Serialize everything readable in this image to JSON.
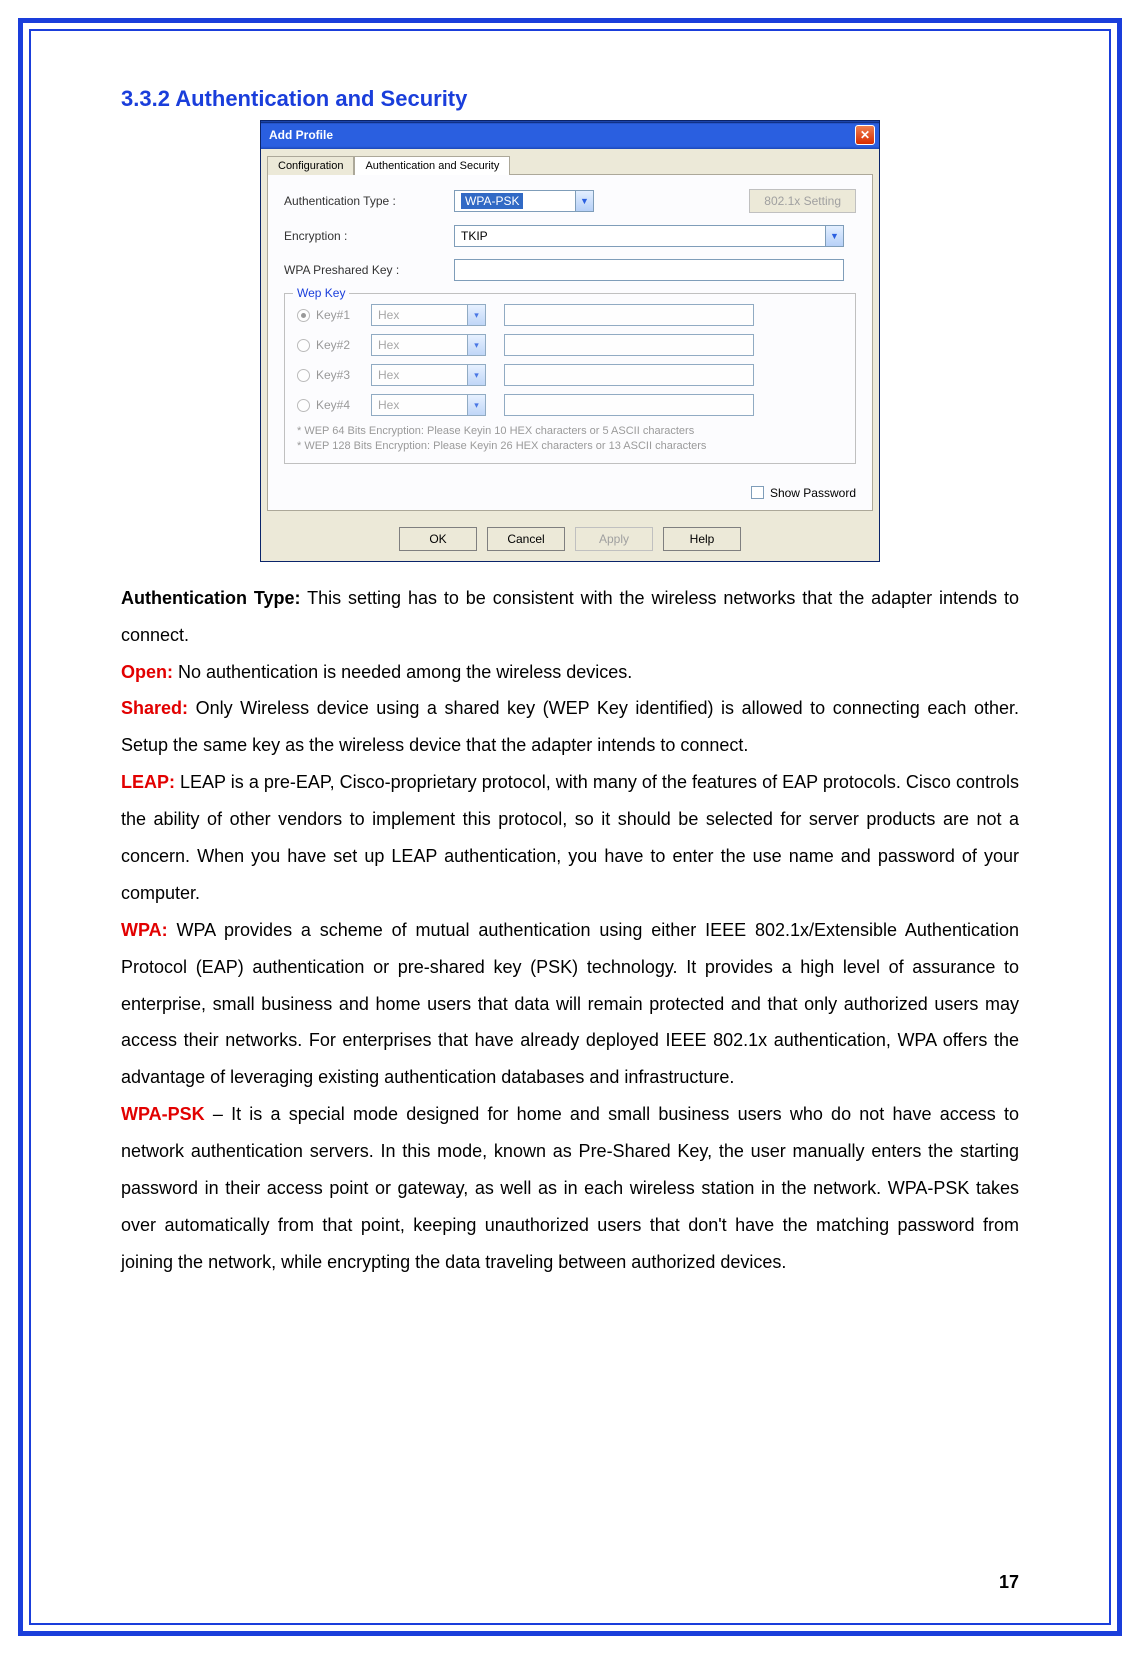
{
  "section_title": "3.3.2 Authentication and Security",
  "dialog": {
    "title": "Add Profile",
    "close_glyph": "✕",
    "tabs": {
      "config": "Configuration",
      "auth": "Authentication and Security"
    },
    "labels": {
      "auth_type": "Authentication Type :",
      "encryption": "Encryption :",
      "psk": "WPA Preshared Key :",
      "dot1x": "802.1x Setting",
      "wep_legend": "Wep Key",
      "show_pw": "Show Password"
    },
    "auth_type_value": "WPA-PSK",
    "encryption_value": "TKIP",
    "wep": {
      "key1": "Key#1",
      "key2": "Key#2",
      "key3": "Key#3",
      "key4": "Key#4",
      "hex": "Hex"
    },
    "hints": {
      "line1": "* WEP 64 Bits Encryption:  Please Keyin 10 HEX characters or 5 ASCII characters",
      "line2": "* WEP 128 Bits Encryption:  Please Keyin 26 HEX characters or 13 ASCII characters"
    },
    "buttons": {
      "ok": "OK",
      "cancel": "Cancel",
      "apply": "Apply",
      "help": "Help"
    }
  },
  "paras": {
    "auth_type_label": "Authentication Type:",
    "auth_type_text": " This setting has to be consistent with the wireless networks that the adapter intends to connect.",
    "open_label": "Open:",
    "open_text": " No authentication is needed among the wireless devices.",
    "shared_label": "Shared:",
    "shared_text": " Only Wireless device using a shared key (WEP Key identified) is allowed to connecting each other. Setup the same key as the wireless device that the adapter intends to connect.",
    "leap_label": "LEAP:",
    "leap_text": " LEAP is a pre-EAP, Cisco-proprietary protocol, with many of the features of EAP protocols. Cisco controls the ability of other vendors to implement this protocol, so it should be selected for server products are not a concern. When you have set up LEAP authentication, you have to enter the use name and password of your computer.",
    "wpa_label": "WPA:",
    "wpa_text": " WPA provides a scheme of mutual authentication using either IEEE 802.1x/Extensible Authentication Protocol (EAP) authentication or pre-shared key (PSK) technology. It provides a high level of assurance to enterprise, small business and home users that data will remain protected and that only authorized users may access their networks. For enterprises that have already deployed IEEE 802.1x authentication, WPA offers the advantage of leveraging existing authentication databases and infrastructure.",
    "wpapsk_label": "WPA-PSK",
    "wpapsk_text": " – It is a special mode designed for home and small business users who do not have access to network authentication servers. In this mode, known as Pre-Shared Key, the user manually enters the starting password in their access point or gateway, as well as in each wireless station in the network. WPA-PSK takes over automatically from that point, keeping unauthorized users that don't have the matching password from joining the network, while encrypting the data traveling between authorized devices."
  },
  "page_number": "17"
}
